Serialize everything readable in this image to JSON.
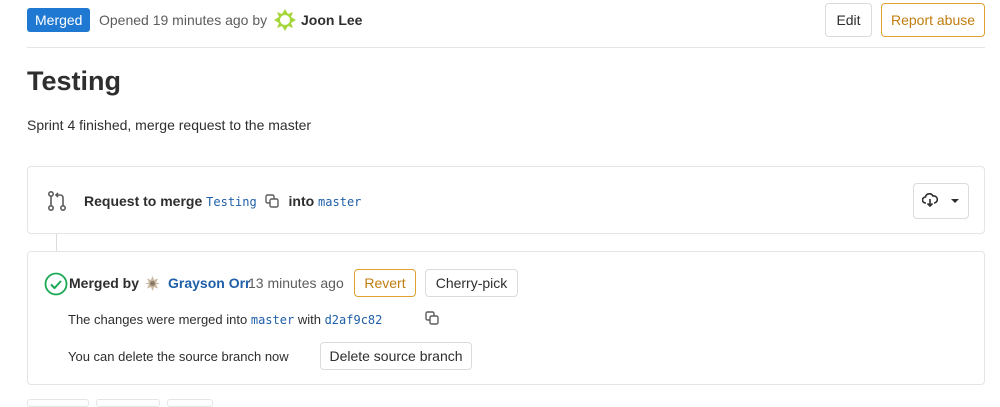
{
  "header": {
    "status_badge": "Merged",
    "opened_text": "Opened 19 minutes ago by",
    "author": "Joon Lee",
    "edit_label": "Edit",
    "report_label": "Report abuse"
  },
  "issue": {
    "title": "Testing",
    "description": "Sprint 4 finished, merge request to the master"
  },
  "request": {
    "prefix": "Request to merge",
    "source_branch": "Testing",
    "into": "into",
    "target_branch": "master",
    "download_icon": "cloud-download-icon"
  },
  "merged": {
    "label": "Merged by",
    "merger": "Grayson Orr",
    "ago": "13 minutes ago",
    "revert_label": "Revert",
    "cherry_label": "Cherry-pick",
    "changes_prefix": "The changes were merged into",
    "changes_branch": "master",
    "changes_with": "with",
    "sha": "d2af9c82",
    "delete_text": "You can delete the source branch now",
    "delete_label": "Delete source branch"
  },
  "colors": {
    "accent_blue": "#1f78d1",
    "link_blue": "#1f5fa8",
    "warning_orange": "#e0a132",
    "success_green": "#1aaa55"
  }
}
